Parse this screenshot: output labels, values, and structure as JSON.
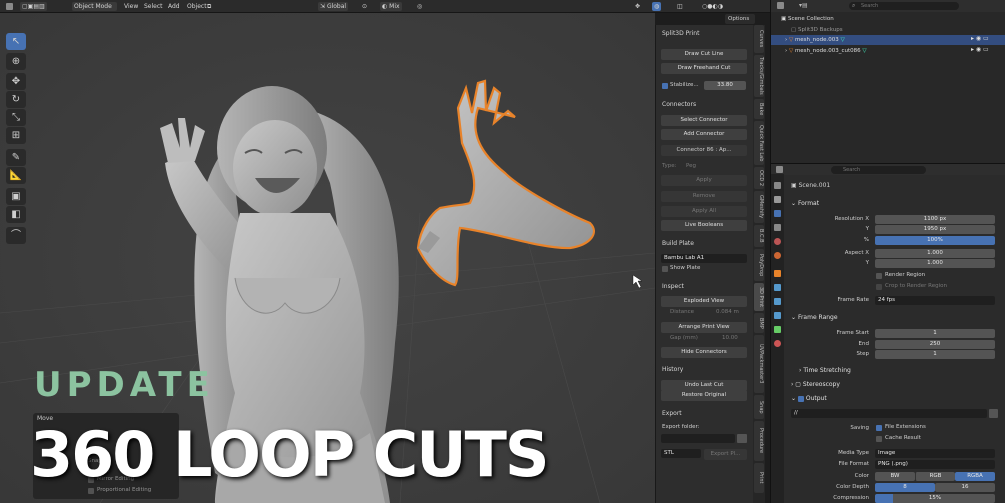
{
  "header": {
    "mode": "Object Mode",
    "menus": [
      "View",
      "Select",
      "Add",
      "Object"
    ],
    "orientation": "Global",
    "pivot": "Mix",
    "options": "Options"
  },
  "vtabs": [
    "Curves",
    "Tracks/Gimbals",
    "Bake",
    "Quick Fast Lab",
    "OCD 2",
    "GMeshify",
    "B.C.B",
    "PolyDrop",
    "3D Print",
    "BMP",
    "UVPackmaster3",
    "Snap",
    "Procedure",
    "Print"
  ],
  "npanel": {
    "title": "Split3D Print",
    "draw_cut": "Draw Cut Line",
    "draw_freehand": "Draw Freehand Cut",
    "stabilize_label": "Stabilize...",
    "stabilize_value": "33.80",
    "connectors": "Connectors",
    "select_connector": "Select Connector",
    "add_connector": "Add Connector",
    "connector_item": "Connector 86 : Ap...",
    "type_label": "Type:",
    "type_value": "Peg",
    "apply": "Apply",
    "remove": "Remove",
    "apply_all": "Apply All",
    "live_booleans": "Live Booleans",
    "build_plate": "Build Plate",
    "printer": "Bambu Lab A1",
    "show_plate": "Show Plate",
    "inspect": "Inspect",
    "exploded_view": "Exploded View",
    "distance_label": "Distance",
    "distance_value": "0.084 m",
    "arrange_view": "Arrange Print View",
    "gap_label": "Gap (mm)",
    "gap_value": "10.00",
    "hide_connectors": "Hide Connectors",
    "history": "History",
    "undo_last_cut": "Undo Last Cut",
    "restore_original": "Restore Original",
    "export": "Export",
    "export_folder": "Export folder:",
    "format": "STL",
    "export_btn": "Export Pl..."
  },
  "outliner": {
    "search_placeholder": "Search",
    "scene_collection": "Scene Collection",
    "items": [
      "Split3D Backups",
      "mesh_node.003",
      "mesh_node.003_cut086"
    ]
  },
  "properties": {
    "search_placeholder": "Search",
    "scene": "Scene.001",
    "format": "Format",
    "res_x_label": "Resolution X",
    "res_x": "1100 px",
    "res_y_label": "Y",
    "res_y": "1950 px",
    "pct_label": "%",
    "pct": "100%",
    "aspect_x_label": "Aspect X",
    "aspect_x": "1.000",
    "aspect_y_label": "Y",
    "aspect_y": "1.000",
    "render_region": "Render Region",
    "crop_region": "Crop to Render Region",
    "frame_rate_label": "Frame Rate",
    "frame_rate": "24 fps",
    "frame_range": "Frame Range",
    "frame_start_label": "Frame Start",
    "frame_start": "1",
    "end_label": "End",
    "end": "250",
    "step_label": "Step",
    "step": "1",
    "time_stretching": "Time Stretching",
    "stereoscopy": "Stereoscopy",
    "output": "Output",
    "output_path": "//",
    "saving_label": "Saving",
    "file_extensions": "File Extensions",
    "cache_result": "Cache Result",
    "media_type_label": "Media Type",
    "media_type": "Image",
    "file_format_label": "File Format",
    "file_format": "PNG (.png)",
    "color_label": "Color",
    "color_opts": [
      "BW",
      "RGB",
      "RGBA"
    ],
    "color_depth_label": "Color Depth",
    "color_depth": [
      "8",
      "16"
    ],
    "compression_label": "Compression",
    "compression": "15%"
  },
  "move_panel": {
    "title": "Move",
    "snap": "Snap",
    "snap_to": "Snap To",
    "mirror_editing": "Mirror Editing",
    "proportional_editing": "Proportional Editing"
  },
  "overlay": {
    "update": "UPDATE",
    "headline": "360 LOOP CUTS"
  },
  "colors": {
    "accent": "#4772b3",
    "selection": "#e8832a",
    "update_text": "#8cc3a0"
  }
}
